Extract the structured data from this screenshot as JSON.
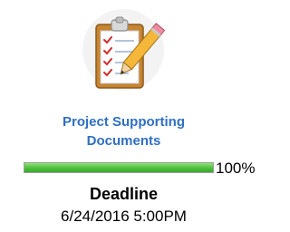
{
  "card": {
    "icon": "clipboard-checklist-pencil-icon",
    "title_lines": [
      "Project Supporting",
      "Documents"
    ],
    "progress": {
      "value": 1.0,
      "label": "100%"
    },
    "deadline": {
      "label": "Deadline",
      "value": "6/24/2016 5:00PM"
    }
  },
  "colors": {
    "title": "#2f6fc2",
    "progress_fill": "#4dbf3c",
    "text": "#000000"
  }
}
